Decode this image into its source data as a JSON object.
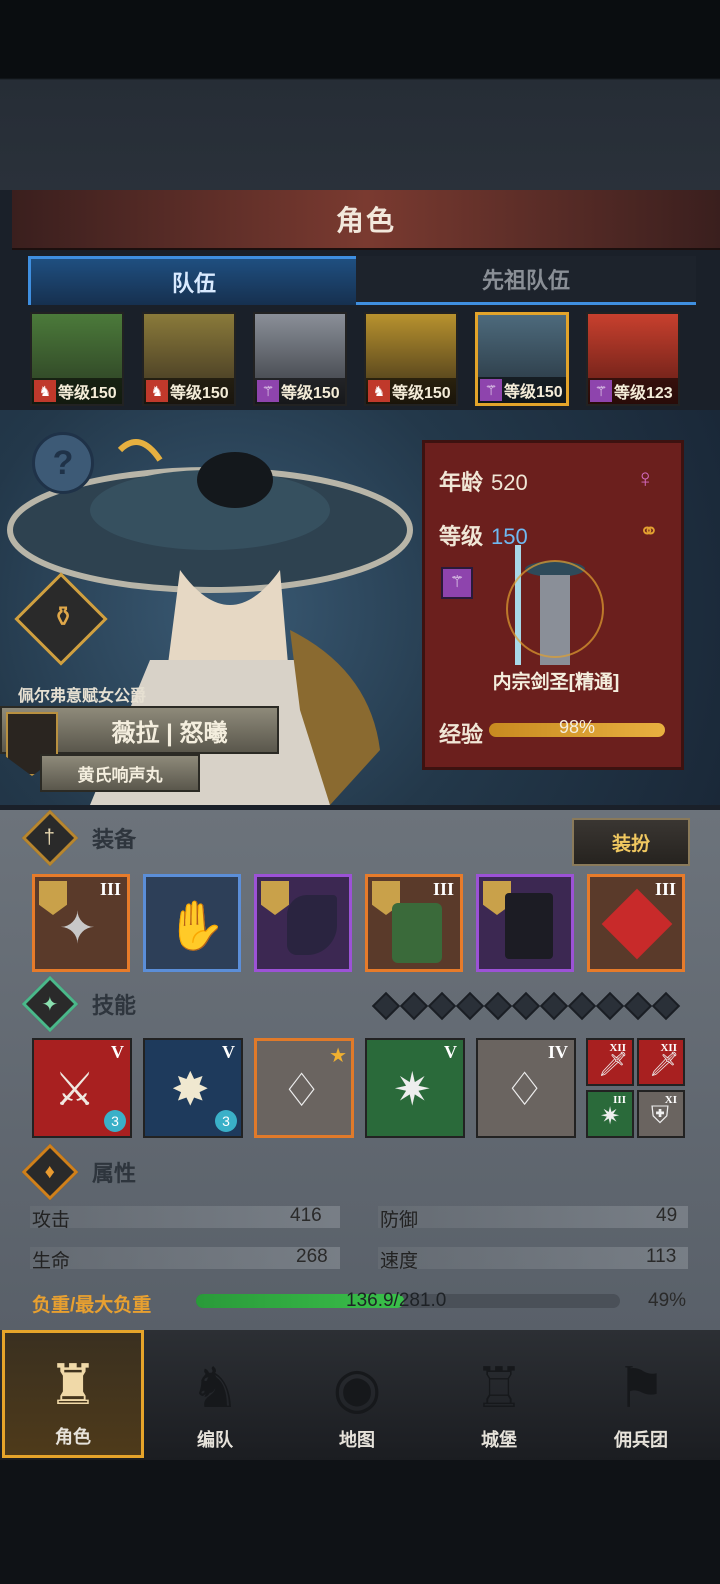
{
  "title": "角色",
  "tabs": [
    {
      "label": "队伍",
      "active": true
    },
    {
      "label": "先祖队伍",
      "active": false
    }
  ],
  "party": [
    {
      "level": "等级150",
      "class_icon": "horse-icon",
      "class_color": "#c0392b",
      "face": "#4b7a3a"
    },
    {
      "level": "等级150",
      "class_icon": "horse-icon",
      "class_color": "#c0392b",
      "face": "#8a7a3a"
    },
    {
      "level": "等级150",
      "class_icon": "staff-icon",
      "class_color": "#8e44ad",
      "face": "#6a6f78"
    },
    {
      "level": "等级150",
      "class_icon": "horse-icon",
      "class_color": "#c0392b",
      "face": "#9a7a2a"
    },
    {
      "level": "等级150",
      "class_icon": "staff-icon",
      "class_color": "#8e44ad",
      "face": "#3d5566",
      "selected": true
    },
    {
      "level": "等级123",
      "class_icon": "staff-icon",
      "class_color": "#8e44ad",
      "face": "#b0302a"
    }
  ],
  "hero": {
    "age_label": "年龄",
    "age": "520",
    "level_label": "等级",
    "level": "150",
    "class_name": "内宗剑圣[精通]",
    "exp_label": "经验",
    "exp_pct": "98%",
    "title_line": "佩尔弗意赋女公爵",
    "name": "薇拉 | 怒曦",
    "sub": "黄氏响声丸"
  },
  "equipment": {
    "label": "装备",
    "outfit_button": "装扮",
    "slots": [
      {
        "rank": "III",
        "color": "orange",
        "icon": "shuriken-icon"
      },
      {
        "rank": "",
        "color": "blue",
        "icon": "gauntlet-icon"
      },
      {
        "rank": "",
        "color": "purple",
        "icon": "cloak-icon"
      },
      {
        "rank": "III",
        "color": "orange",
        "icon": "armor-icon"
      },
      {
        "rank": "",
        "color": "purple",
        "icon": "boots-icon"
      },
      {
        "rank": "III",
        "color": "orange",
        "icon": "knot-charm-icon"
      }
    ]
  },
  "skills": {
    "label": "技能",
    "items": [
      {
        "rank": "V",
        "badge": "3"
      },
      {
        "rank": "V",
        "badge": "3"
      },
      {
        "rank": "",
        "star": true
      },
      {
        "rank": "V"
      },
      {
        "rank": "IV"
      }
    ],
    "mini": [
      "XII",
      "XII",
      "III",
      "XI"
    ]
  },
  "attributes": {
    "label": "属性",
    "attack_label": "攻击",
    "attack": "416",
    "defense_label": "防御",
    "defense": "49",
    "hp_label": "生命",
    "hp": "268",
    "speed_label": "速度",
    "speed": "113",
    "load_label": "负重/最大负重",
    "load": "136.9/281.0",
    "load_pct": "49%",
    "load_fraction": 0.49
  },
  "nav": [
    {
      "label": "角色",
      "active": true
    },
    {
      "label": "编队"
    },
    {
      "label": "地图"
    },
    {
      "label": "城堡"
    },
    {
      "label": "佣兵团"
    }
  ]
}
